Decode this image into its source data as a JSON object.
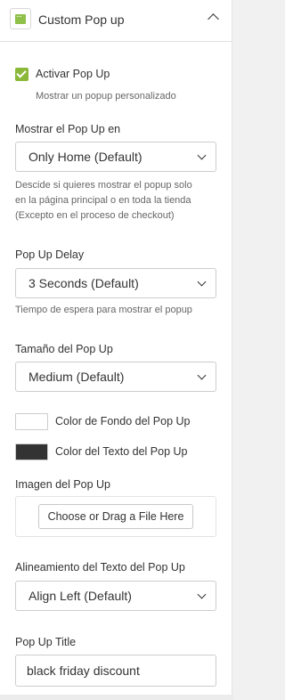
{
  "header": {
    "title": "Custom Pop up",
    "icon": "popup-window-icon",
    "accent": "#8ec04a"
  },
  "activate": {
    "label": "Activar Pop Up",
    "checked": true,
    "help": "Mostrar un popup personalizado"
  },
  "show_on": {
    "label": "Mostrar el Pop Up en",
    "value": "Only Home (Default)",
    "help": [
      "Descide si quieres mostrar el popup solo",
      "en la página principal o en toda la tienda",
      "(Excepto en el proceso de checkout)"
    ]
  },
  "delay": {
    "label": "Pop Up Delay",
    "value": "3 Seconds (Default)",
    "help": "Tiempo de espera para mostrar el popup"
  },
  "size": {
    "label": "Tamaño del Pop Up",
    "value": "Medium (Default)"
  },
  "bg_color": {
    "label": "Color de Fondo del Pop Up",
    "color": "#ffffff"
  },
  "text_color": {
    "label": "Color del Texto del Pop Up",
    "color": "#333333"
  },
  "image": {
    "label": "Imagen del Pop Up",
    "button": "Choose or Drag a File Here"
  },
  "align": {
    "label": "Alineamiento del Texto del Pop Up",
    "value": "Align Left (Default)"
  },
  "title_field": {
    "label": "Pop Up Title",
    "value": "black friday discount"
  }
}
